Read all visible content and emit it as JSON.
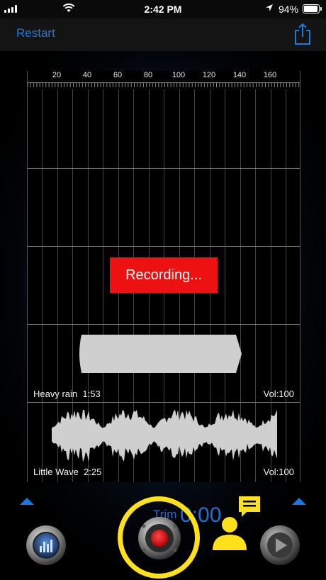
{
  "status_bar": {
    "time": "2:42 PM",
    "battery_percent": "94%",
    "battery_level": 0.94
  },
  "nav": {
    "restart_label": "Restart",
    "share_icon": "share-icon"
  },
  "timeline": {
    "ruler_labels": [
      "20",
      "40",
      "60",
      "80",
      "100",
      "120",
      "140",
      "160"
    ],
    "recording_label": "Recording...",
    "tracks": [
      {
        "name": "Heavy rain",
        "duration": "1:53",
        "volume": "Vol:100"
      },
      {
        "name": "Little Wave",
        "duration": "2:25",
        "volume": "Vol:100"
      }
    ]
  },
  "controls": {
    "trim_label": "Trim",
    "trim_time": "0:00",
    "mixer_icon": "equalizer-icon",
    "record_icon": "record-icon",
    "play_icon": "play-icon",
    "chat_icon": "chat-bubble-icon",
    "person_icon": "person-icon",
    "accent_color": "#1f7ae0",
    "record_ring_color": "#ffe11a",
    "recording_badge_color": "#ee1111"
  }
}
